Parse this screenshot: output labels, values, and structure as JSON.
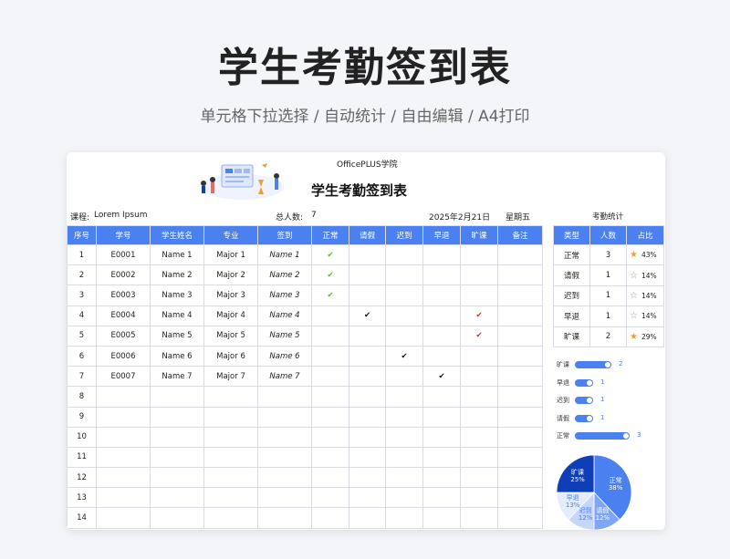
{
  "hero": {
    "title": "学生考勤签到表",
    "subtitle": "单元格下拉选择 / 自动统计 / 自由编辑 / A4打印"
  },
  "sheet": {
    "org": "OfficePLUS学院",
    "title": "学生考勤签到表",
    "course_label": "课程:",
    "course_value": "Lorem Ipsum",
    "total_label": "总人数:",
    "total_value": "7",
    "date": "2025年2月21日",
    "weekday": "星期五"
  },
  "table": {
    "headers": [
      "序号",
      "学号",
      "学生姓名",
      "专业",
      "签到",
      "正常",
      "请假",
      "迟到",
      "早退",
      "旷课",
      "备注"
    ],
    "check_mark": "✔",
    "rows": [
      {
        "no": "1",
        "id": "E0001",
        "name": "Name 1",
        "major": "Major 1",
        "sign": "Name 1",
        "status": "正常"
      },
      {
        "no": "2",
        "id": "E0002",
        "name": "Name 2",
        "major": "Major 2",
        "sign": "Name 2",
        "status": "正常"
      },
      {
        "no": "3",
        "id": "E0003",
        "name": "Name 3",
        "major": "Major 3",
        "sign": "Name 3",
        "status": "正常"
      },
      {
        "no": "4",
        "id": "E0004",
        "name": "Name 4",
        "major": "Major 4",
        "sign": "Name 4",
        "status": "请假+旷课"
      },
      {
        "no": "5",
        "id": "E0005",
        "name": "Name 5",
        "major": "Major 5",
        "sign": "Name 5",
        "status": "旷课"
      },
      {
        "no": "6",
        "id": "E0006",
        "name": "Name 6",
        "major": "Major 6",
        "sign": "Name 6",
        "status": "迟到"
      },
      {
        "no": "7",
        "id": "E0007",
        "name": "Name 7",
        "major": "Major 7",
        "sign": "Name 7",
        "status": "早退"
      },
      {
        "no": "8"
      },
      {
        "no": "9"
      },
      {
        "no": "10"
      },
      {
        "no": "11"
      },
      {
        "no": "12"
      },
      {
        "no": "13"
      },
      {
        "no": "14"
      }
    ]
  },
  "stats": {
    "title": "考勤统计",
    "headers": [
      "类型",
      "人数",
      "占比"
    ],
    "rows": [
      {
        "type": "正常",
        "count": "3",
        "pct": "43%",
        "star": "half"
      },
      {
        "type": "请假",
        "count": "1",
        "pct": "14%",
        "star": "empty"
      },
      {
        "type": "迟到",
        "count": "1",
        "pct": "14%",
        "star": "empty"
      },
      {
        "type": "早退",
        "count": "1",
        "pct": "14%",
        "star": "empty"
      },
      {
        "type": "旷课",
        "count": "2",
        "pct": "29%",
        "star": "half"
      }
    ]
  },
  "bar_chart": {
    "categories": [
      "旷课",
      "早退",
      "迟到",
      "请假",
      "正常"
    ],
    "values": [
      2,
      1,
      1,
      1,
      3
    ],
    "color": "#4a80f0"
  },
  "pie_chart": {
    "slices": [
      {
        "label": "正常",
        "pct": "38%",
        "value": 38,
        "color": "#4a80f0"
      },
      {
        "label": "请假",
        "pct": "12%",
        "value": 12,
        "color": "#7ea6f5"
      },
      {
        "label": "迟到",
        "pct": "12%",
        "value": 12,
        "color": "#c5d6fb"
      },
      {
        "label": "早退",
        "pct": "13%",
        "value": 13,
        "color": "#e3ebfd"
      },
      {
        "label": "旷课",
        "pct": "25%",
        "value": 25,
        "color": "#0f3fb8"
      }
    ]
  }
}
